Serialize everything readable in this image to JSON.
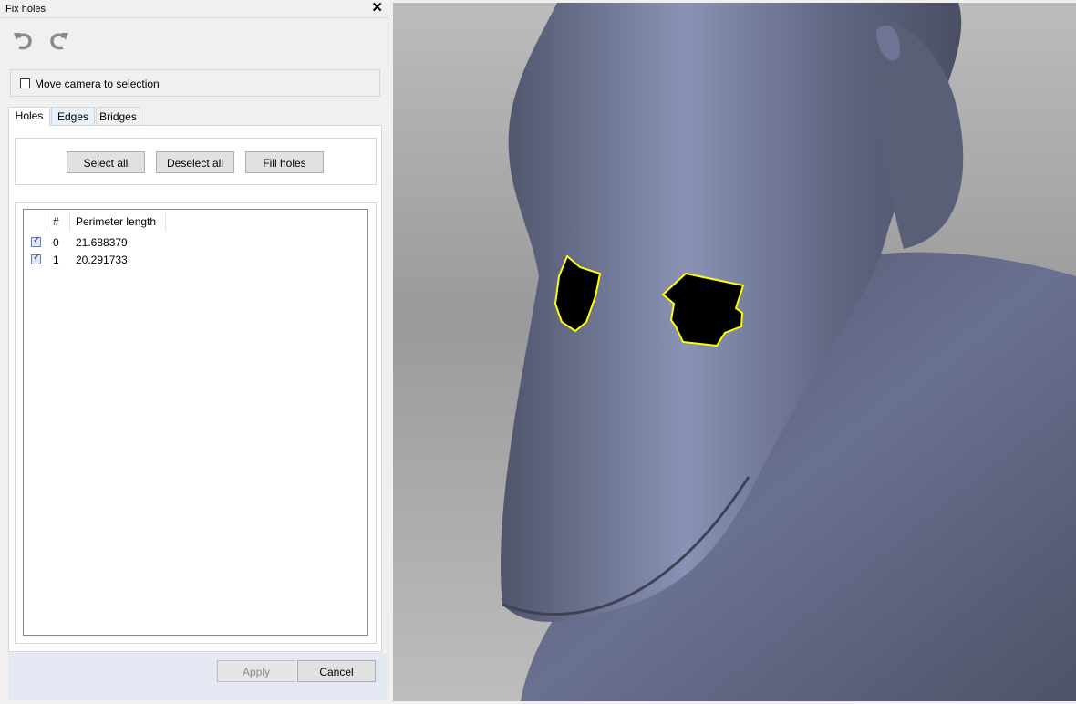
{
  "window": {
    "title": "Fix holes",
    "close_label": "✕"
  },
  "toolbar": {
    "undo_icon": "undo-icon",
    "redo_icon": "redo-icon"
  },
  "camera": {
    "label": "Move camera to selection",
    "checked": false
  },
  "tabs": [
    {
      "label": "Holes",
      "active": true
    },
    {
      "label": "Edges",
      "active": false
    },
    {
      "label": "Bridges",
      "active": false
    }
  ],
  "actions": {
    "select_all": "Select all",
    "deselect_all": "Deselect all",
    "fill_holes": "Fill holes"
  },
  "table": {
    "columns": [
      "#",
      "Perimeter length"
    ],
    "rows": [
      {
        "checked": true,
        "index": "0",
        "perimeter": "21.688379"
      },
      {
        "checked": true,
        "index": "1",
        "perimeter": "20.291733"
      }
    ]
  },
  "footer": {
    "apply": "Apply",
    "cancel": "Cancel"
  },
  "colors": {
    "mesh": "#5c6179",
    "mesh_highlight": "#8d96b8",
    "hole_outline": "#ffff00",
    "hole_fill": "#000000"
  }
}
